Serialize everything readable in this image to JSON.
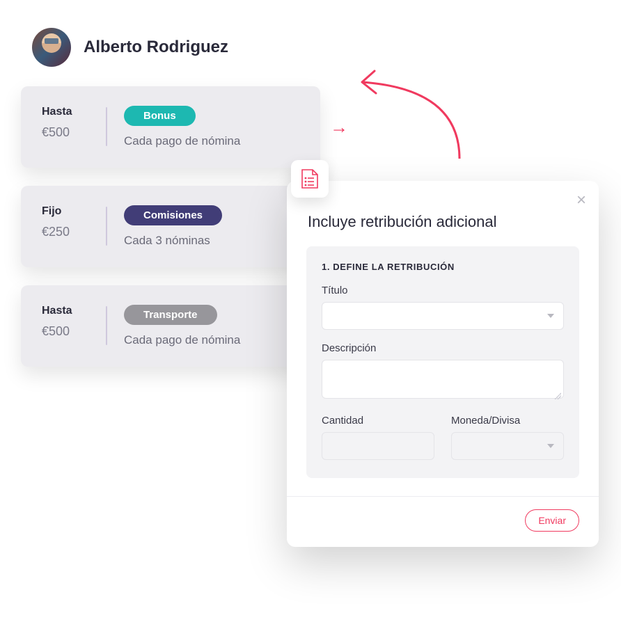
{
  "user": {
    "name": "Alberto Rodriguez"
  },
  "cards": [
    {
      "label": "Hasta",
      "amount": "€500",
      "chip": "Bonus",
      "chip_style": "teal",
      "freq": "Cada pago de nómina"
    },
    {
      "label": "Fijo",
      "amount": "€250",
      "chip": "Comisiones",
      "chip_style": "indigo",
      "freq": "Cada 3 nóminas"
    },
    {
      "label": "Hasta",
      "amount": "€500",
      "chip": "Transporte",
      "chip_style": "gray",
      "freq": "Cada pago de nómina"
    }
  ],
  "modal": {
    "title": "Incluye retribución adicional",
    "step": "1. DEFINE LA RETRIBUCIÓN",
    "labels": {
      "title": "Título",
      "description": "Descripción",
      "quantity": "Cantidad",
      "currency": "Moneda/Divisa"
    },
    "values": {
      "title": "",
      "description": "",
      "quantity": "",
      "currency": ""
    },
    "submit": "Enviar"
  },
  "colors": {
    "accent": "#f03a5f",
    "teal": "#1db8b1",
    "indigo": "#413d77",
    "gray": "#97969b"
  }
}
